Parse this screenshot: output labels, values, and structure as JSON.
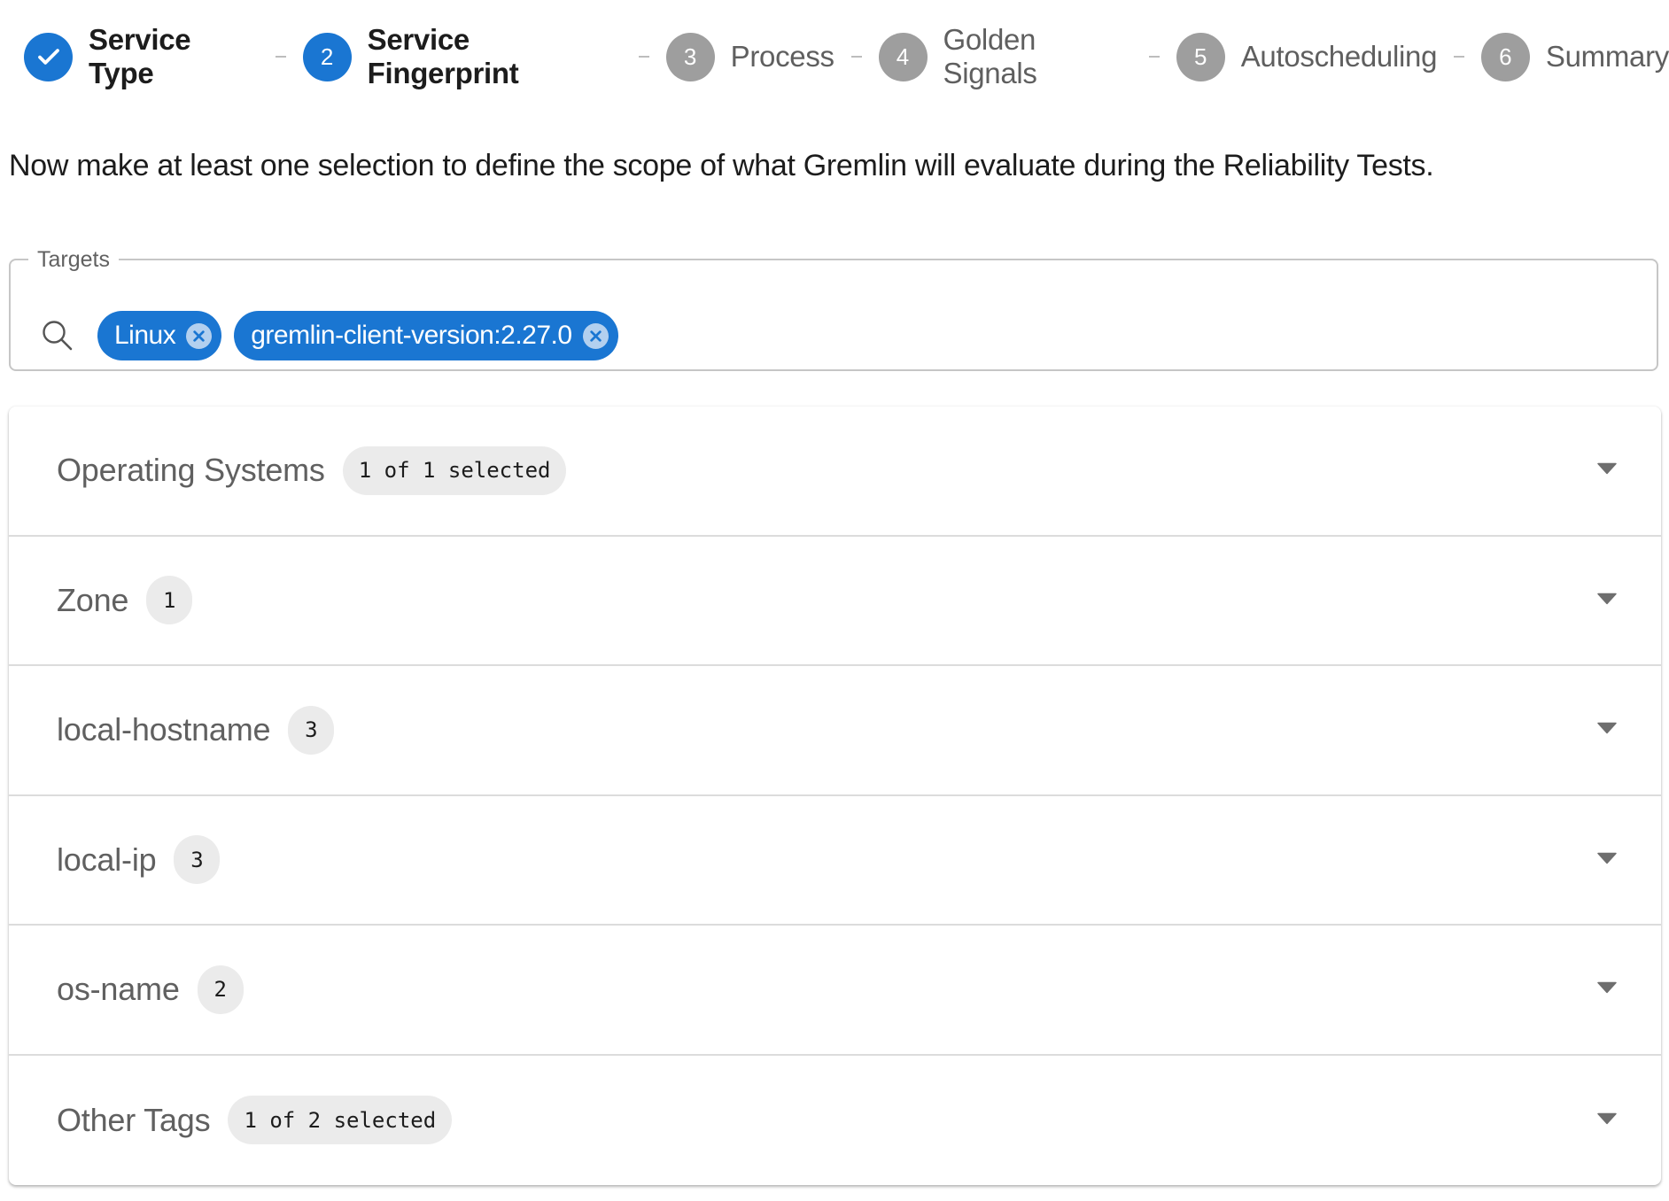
{
  "stepper": {
    "steps": [
      {
        "number": "1",
        "label": "Service Type",
        "state": "completed",
        "icon": "check-icon"
      },
      {
        "number": "2",
        "label": "Service Fingerprint",
        "state": "active"
      },
      {
        "number": "3",
        "label": "Process",
        "state": "inactive"
      },
      {
        "number": "4",
        "label": "Golden Signals",
        "state": "inactive"
      },
      {
        "number": "5",
        "label": "Autoscheduling",
        "state": "inactive"
      },
      {
        "number": "6",
        "label": "Summary",
        "state": "inactive"
      }
    ]
  },
  "description": "Now make at least one selection to define the scope of what Gremlin will evaluate during the Reliability Tests.",
  "targets": {
    "legend": "Targets",
    "search_icon": "search-icon",
    "chips": [
      {
        "label": "Linux",
        "remove_icon": "close-circle-icon"
      },
      {
        "label": "gremlin-client-version:2.27.0",
        "remove_icon": "close-circle-icon"
      }
    ]
  },
  "accordion": {
    "sections": [
      {
        "title": "Operating Systems",
        "badge": "1 of 1 selected",
        "expanded": false
      },
      {
        "title": "Zone",
        "badge": "1",
        "expanded": false
      },
      {
        "title": "local-hostname",
        "badge": "3",
        "expanded": false
      },
      {
        "title": "local-ip",
        "badge": "3",
        "expanded": false
      },
      {
        "title": "os-name",
        "badge": "2",
        "expanded": false
      },
      {
        "title": "Other Tags",
        "badge": "1 of 2 selected",
        "expanded": false
      }
    ]
  },
  "colors": {
    "accent": "#1a76d2",
    "inactive_step": "#9e9e9e",
    "chip_remove_bg": "#b3d0ef",
    "badge_bg": "#ebebeb"
  }
}
